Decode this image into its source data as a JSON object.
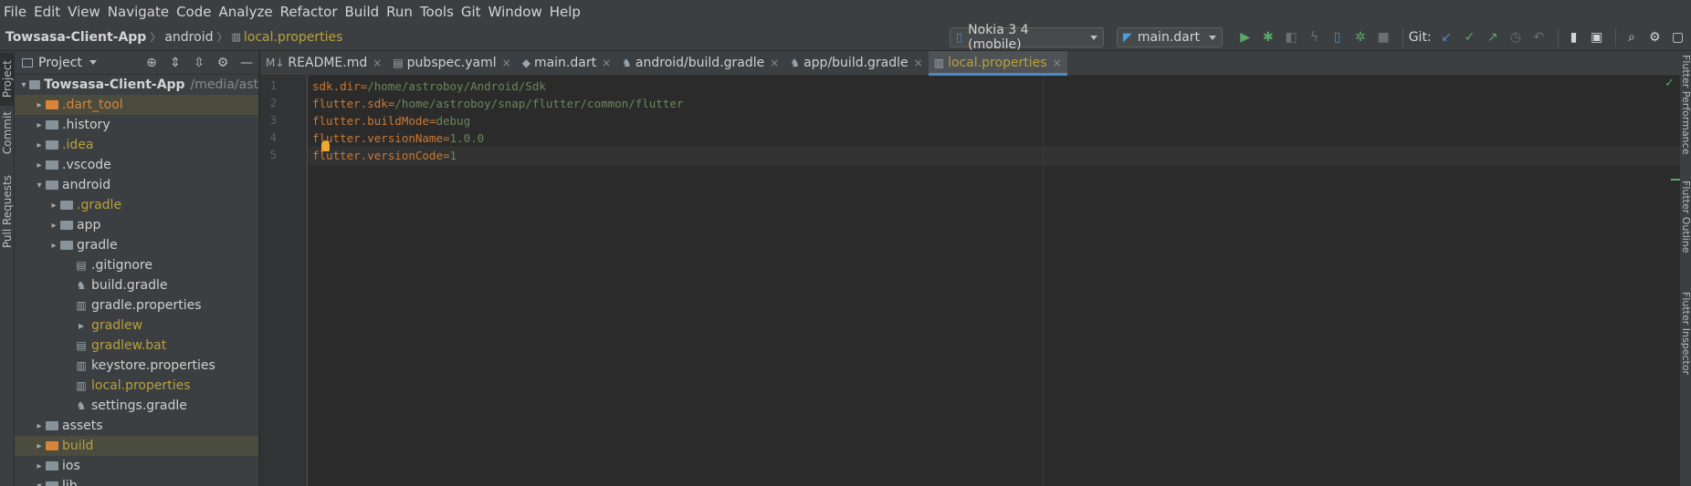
{
  "menu": [
    "File",
    "Edit",
    "View",
    "Navigate",
    "Code",
    "Analyze",
    "Refactor",
    "Build",
    "Run",
    "Tools",
    "Git",
    "Window",
    "Help"
  ],
  "breadcrumb": {
    "project": "Towsasa-Client-App",
    "folder": "android",
    "file": "local.properties"
  },
  "toolbar": {
    "device": "Nokia 3 4 (mobile)",
    "run_config": "main.dart",
    "git_label": "Git:"
  },
  "left_tabs": [
    "Project",
    "Commit",
    "Pull Requests"
  ],
  "right_tabs": [
    "Flutter Performance",
    "Flutter Outline",
    "Flutter Inspector"
  ],
  "project_panel": {
    "title": "Project",
    "tree": [
      {
        "label": "Towsasa-Client-App",
        "suffix": "/media/ast",
        "arrow": "v",
        "icon": "folder",
        "color": "bold"
      },
      {
        "label": ".dart_tool",
        "arrow": ">",
        "icon": "folder-orange",
        "color": "orange",
        "selected": true
      },
      {
        "label": ".history",
        "arrow": ">",
        "icon": "folder",
        "color": "plain"
      },
      {
        "label": ".idea",
        "arrow": ">",
        "icon": "folder",
        "color": "yellow"
      },
      {
        "label": ".vscode",
        "arrow": ">",
        "icon": "folder",
        "color": "plain"
      },
      {
        "label": "android",
        "arrow": "v",
        "icon": "folder",
        "color": "plain"
      },
      {
        "label": ".gradle",
        "arrow": ">",
        "icon": "folder",
        "color": "yellow"
      },
      {
        "label": "app",
        "arrow": ">",
        "icon": "folder",
        "color": "plain"
      },
      {
        "label": "gradle",
        "arrow": ">",
        "icon": "folder",
        "color": "plain"
      },
      {
        "label": ".gitignore",
        "arrow": "",
        "icon": "file",
        "color": "plain"
      },
      {
        "label": "build.gradle",
        "arrow": "",
        "icon": "gradle",
        "color": "plain"
      },
      {
        "label": "gradle.properties",
        "arrow": "",
        "icon": "properties",
        "color": "plain"
      },
      {
        "label": "gradlew",
        "arrow": "",
        "icon": "script",
        "color": "yellow"
      },
      {
        "label": "gradlew.bat",
        "arrow": "",
        "icon": "file",
        "color": "yellow"
      },
      {
        "label": "keystore.properties",
        "arrow": "",
        "icon": "properties",
        "color": "plain"
      },
      {
        "label": "local.properties",
        "arrow": "",
        "icon": "properties",
        "color": "yellow"
      },
      {
        "label": "settings.gradle",
        "arrow": "",
        "icon": "gradle",
        "color": "plain"
      },
      {
        "label": "assets",
        "arrow": ">",
        "icon": "folder",
        "color": "plain"
      },
      {
        "label": "build",
        "arrow": ">",
        "icon": "folder-orange",
        "color": "yellow",
        "selected": true
      },
      {
        "label": "ios",
        "arrow": ">",
        "icon": "folder",
        "color": "plain"
      },
      {
        "label": "lib",
        "arrow": "v",
        "icon": "folder",
        "color": "plain"
      }
    ]
  },
  "editor_tabs": [
    {
      "label": "README.md",
      "icon": "markdown",
      "active": false
    },
    {
      "label": "pubspec.yaml",
      "icon": "yaml",
      "active": false
    },
    {
      "label": "main.dart",
      "icon": "dart",
      "active": false
    },
    {
      "label": "android/build.gradle",
      "icon": "gradle",
      "active": false
    },
    {
      "label": "app/build.gradle",
      "icon": "gradle",
      "active": false
    },
    {
      "label": "local.properties",
      "icon": "properties",
      "active": true
    }
  ],
  "code_lines": [
    {
      "n": "1",
      "key": "sdk.dir",
      "val": "/home/astroboy/Android/Sdk"
    },
    {
      "n": "2",
      "key": "flutter.sdk",
      "val": "/home/astroboy/snap/flutter/common/flutter"
    },
    {
      "n": "3",
      "key": "flutter.buildMode",
      "val": "debug"
    },
    {
      "n": "4",
      "key": "flutter.versionName",
      "val": "1.0.0"
    },
    {
      "n": "5",
      "key": "flutter.versionCode",
      "val": "1",
      "current": true
    }
  ]
}
